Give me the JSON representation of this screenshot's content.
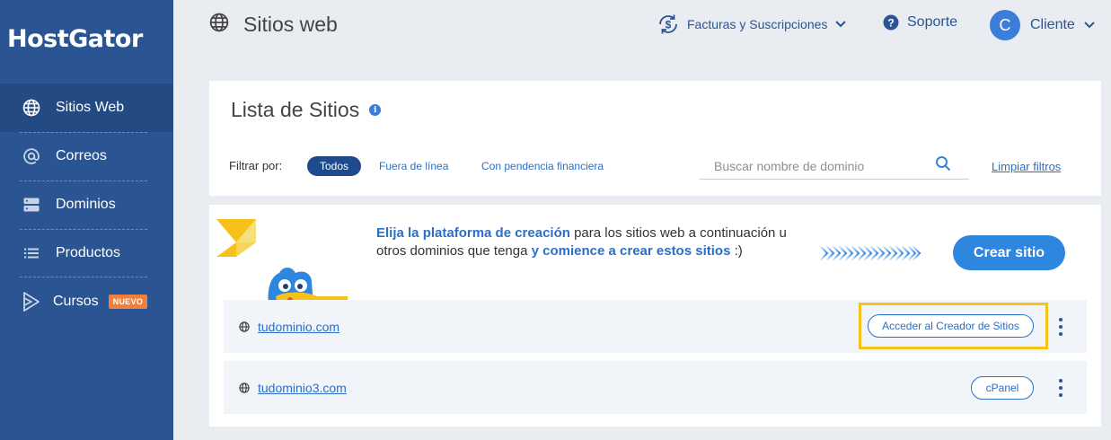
{
  "sidebar": {
    "logo": "HostGator",
    "items": [
      {
        "label": "Sitios Web",
        "icon": "globe-icon"
      },
      {
        "label": "Correos",
        "icon": "at-icon"
      },
      {
        "label": "Dominios",
        "icon": "server-icon"
      },
      {
        "label": "Productos",
        "icon": "list-icon"
      },
      {
        "label": "Cursos",
        "icon": "play-icon",
        "badge": "NUEVO"
      }
    ]
  },
  "header": {
    "title": "Sitios web",
    "billing_label": "Facturas y Suscripciones",
    "support_label": "Soporte",
    "user_initial": "C",
    "user_label": "Cliente"
  },
  "filters": {
    "title": "Lista de Sitios",
    "info": "i",
    "filter_label": "Filtrar por:",
    "chips": [
      "Todos",
      "Fuera de línea",
      "Con pendencia financiera"
    ],
    "search_placeholder": "Buscar nombre de dominio",
    "search_value": "",
    "clear_label": "Limpiar filtros"
  },
  "promo": {
    "part1": "Elija la plataforma de creación",
    "part2": " para los sitios web a continuación u otros dominios que tenga ",
    "part3": "y comience a crear estos sitios",
    "part4": " :)",
    "button_label": "Crear sitio"
  },
  "sites": [
    {
      "domain": "tudominio.com",
      "action_label": "Acceder al Creador de Sitios"
    },
    {
      "domain": "tudominio3.com",
      "action_label": "cPanel"
    }
  ],
  "colors": {
    "sidebar": "#2b5592",
    "accent": "#2e86de",
    "link": "#2b6fc7",
    "highlight": "#f6c21a",
    "badge": "#f07e3d"
  }
}
